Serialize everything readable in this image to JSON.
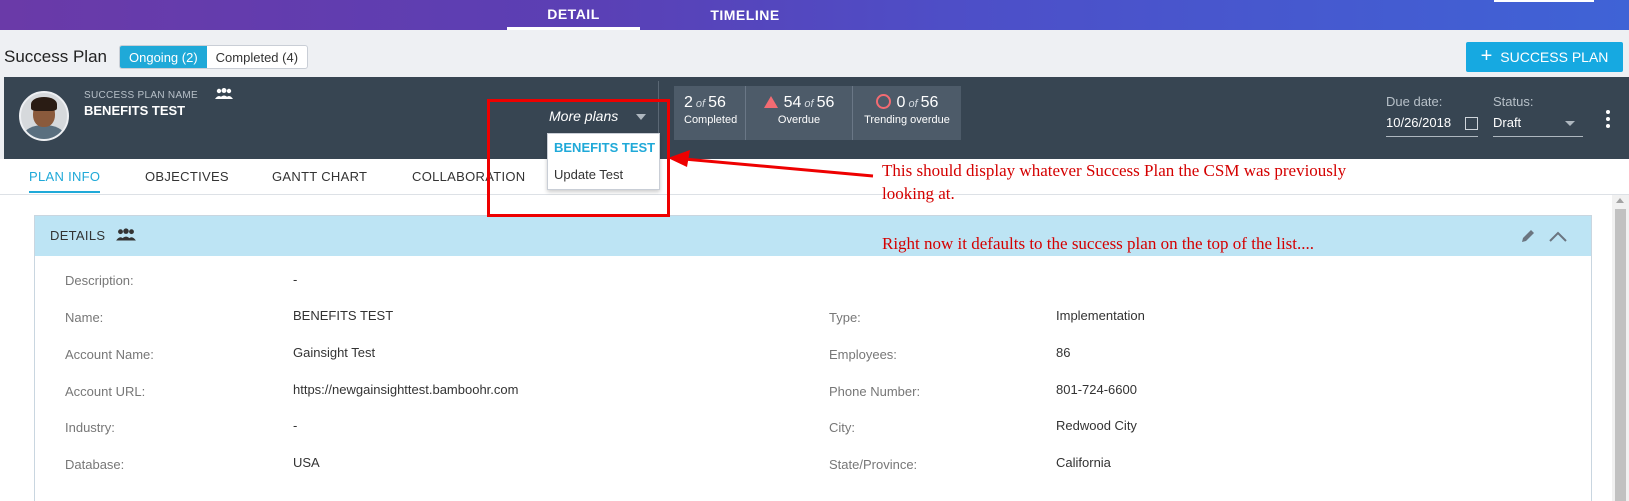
{
  "top_tabs": {
    "detail": "DETAIL",
    "timeline": "TIMELINE"
  },
  "header": {
    "title": "Success Plan",
    "ongoing": "Ongoing (2)",
    "completed": "Completed (4)",
    "add_button": "SUCCESS PLAN"
  },
  "plan": {
    "label": "SUCCESS PLAN NAME",
    "name": "BENEFITS TEST",
    "more_plans": "More plans",
    "stats": [
      {
        "value": "2",
        "of": "of",
        "total": "56",
        "label": "Completed"
      },
      {
        "value": "54",
        "of": "of",
        "total": "56",
        "label": "Overdue"
      },
      {
        "value": "0",
        "of": "of",
        "total": "56",
        "label": "Trending overdue"
      }
    ],
    "due_label": "Due date:",
    "due_value": "10/26/2018",
    "status_label": "Status:",
    "status_value": "Draft"
  },
  "dropdown": {
    "selected": "BENEFITS TEST",
    "other": "Update Test"
  },
  "plan_tabs": [
    "PLAN INFO",
    "OBJECTIVES",
    "GANTT CHART",
    "COLLABORATION"
  ],
  "details": {
    "title": "DETAILS",
    "left_fields": [
      {
        "label": "Description:",
        "value": "-"
      },
      {
        "label": "Name:",
        "value": "BENEFITS TEST"
      },
      {
        "label": "Account Name:",
        "value": "Gainsight Test"
      },
      {
        "label": "Account URL:",
        "value": "https://newgainsighttest.bamboohr.com"
      },
      {
        "label": "Industry:",
        "value": "-"
      },
      {
        "label": "Database:",
        "value": "USA"
      }
    ],
    "right_fields": [
      {
        "label": "Type:",
        "value": "Implementation"
      },
      {
        "label": "Employees:",
        "value": "86"
      },
      {
        "label": "Phone Number:",
        "value": "801-724-6600"
      },
      {
        "label": "City:",
        "value": "Redwood City"
      },
      {
        "label": "State/Province:",
        "value": "California"
      }
    ]
  },
  "annotations": {
    "line1": "This should display whatever Success Plan the CSM was previously",
    "line2": "looking at.",
    "line3": "Right now it defaults to the success plan on the top of the list...."
  },
  "colors": {
    "accent": "#1fa9d8",
    "header_dark": "#374552",
    "annotation": "#d40000"
  }
}
